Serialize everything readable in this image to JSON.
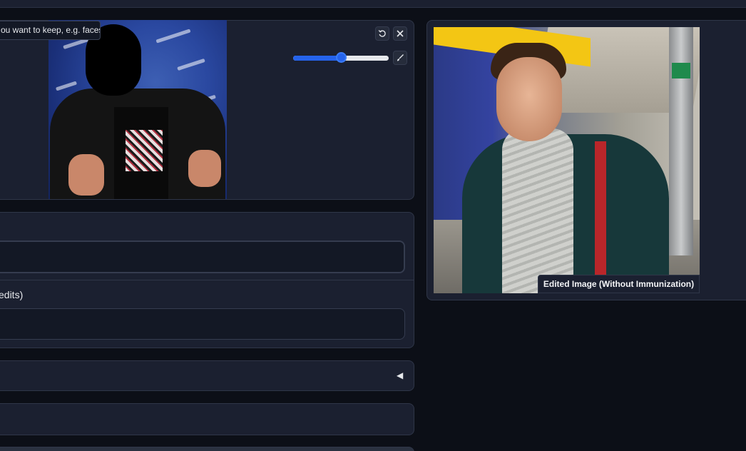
{
  "tooltip": {
    "text": "ou want to keep, e.g. faces"
  },
  "editor": {
    "brush_size_percent": 50,
    "icons": {
      "undo": "undo-icon",
      "close": "close-icon",
      "brush": "brush-icon"
    }
  },
  "result": {
    "caption": "Edited Image (Without Immunization)"
  },
  "prompt": {
    "value": ""
  },
  "edit_prompt": {
    "label": "edits)",
    "value": ""
  },
  "accordion": {
    "icon": "◀"
  },
  "colors": {
    "accent": "#2563eb",
    "background": "#0c0f17",
    "panel": "#1b2030"
  }
}
